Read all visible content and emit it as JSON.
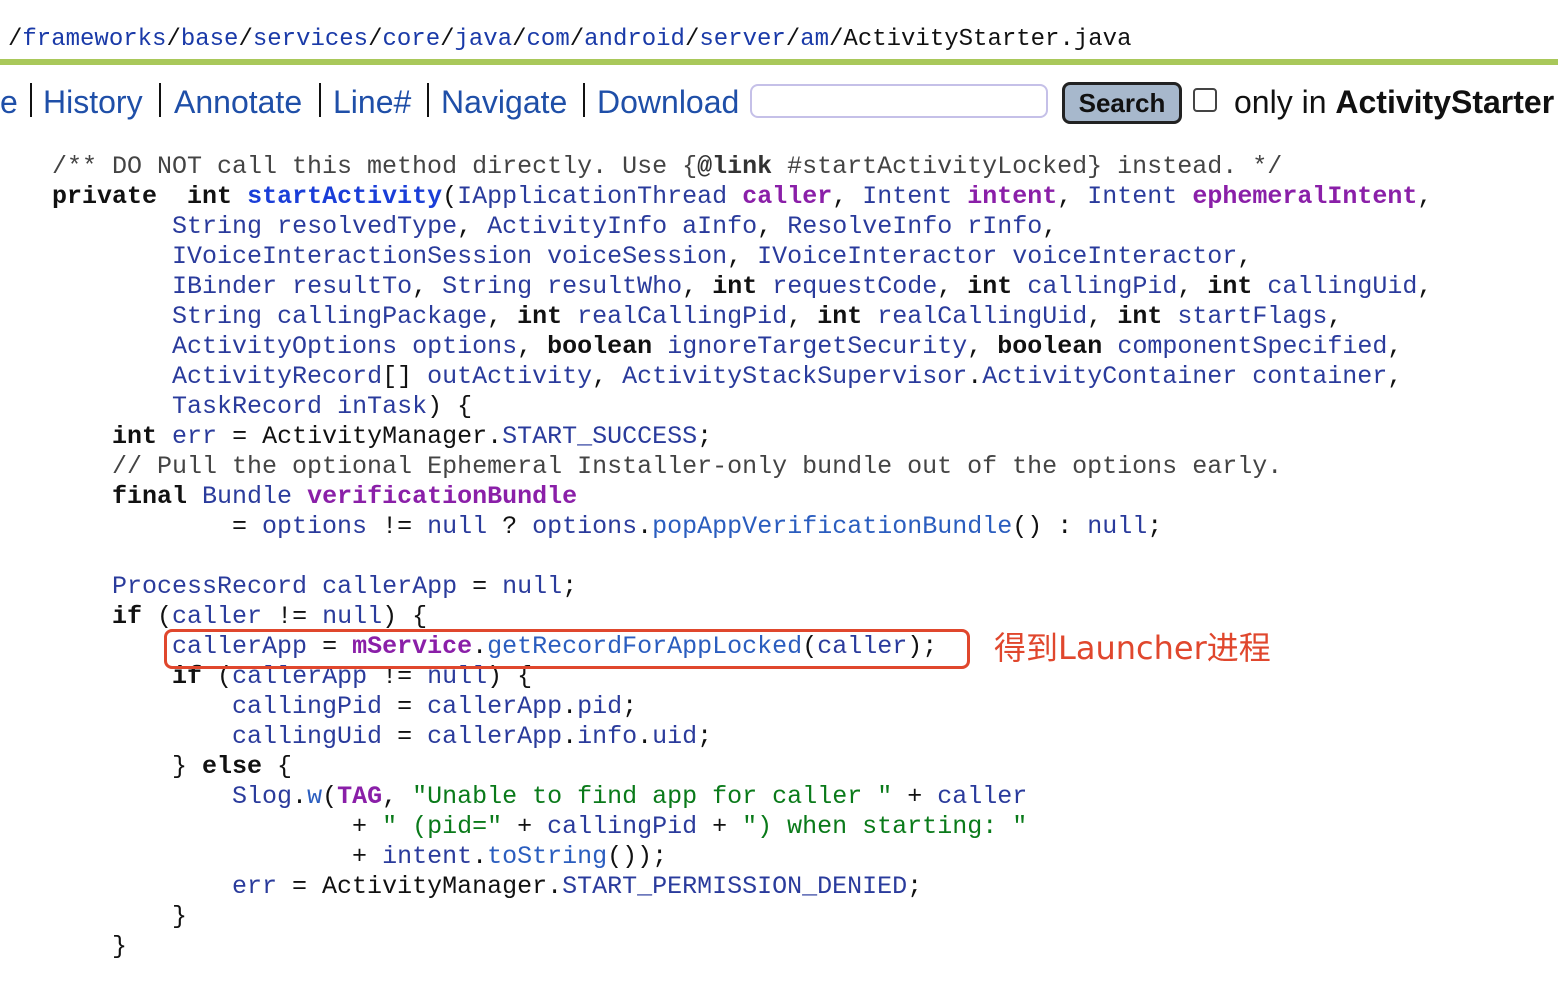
{
  "breadcrumb": {
    "sep": "/",
    "parts": [
      "frameworks",
      "base",
      "services",
      "core",
      "java",
      "com",
      "android",
      "server",
      "am",
      "ActivityStarter.java"
    ]
  },
  "navbar": {
    "items": [
      "e",
      "History",
      "Annotate",
      "Line#",
      "Navigate",
      "Download"
    ],
    "search_value": "",
    "search_button": "Search",
    "only_in": "only in",
    "only_in_target": "ActivityStarter"
  },
  "annotation": {
    "note": "得到Launcher进程",
    "box_color": "#e0472d"
  },
  "code": {
    "line01": [
      [
        "c",
        "/** DO NOT call this method directly. Use {"
      ],
      [
        "cb",
        "@link"
      ],
      [
        "c",
        " #startActivityLocked} instead. */"
      ]
    ],
    "line02": [
      [
        "k",
        "private"
      ],
      [
        "",
        "  "
      ],
      [
        "k",
        "int"
      ],
      [
        "",
        " "
      ],
      [
        "fb",
        "startActivity"
      ],
      [
        "",
        "("
      ],
      [
        "t",
        "IApplicationThread"
      ],
      [
        "",
        " "
      ],
      [
        "pb",
        "caller"
      ],
      [
        "",
        ", "
      ],
      [
        "t",
        "Intent"
      ],
      [
        "",
        " "
      ],
      [
        "pb",
        "intent"
      ],
      [
        "",
        ", "
      ],
      [
        "t",
        "Intent"
      ],
      [
        "",
        " "
      ],
      [
        "pb",
        "ephemeralIntent"
      ],
      [
        "",
        ","
      ]
    ],
    "line03": [
      [
        "",
        "        "
      ],
      [
        "t",
        "String"
      ],
      [
        "",
        " "
      ],
      [
        "v",
        "resolvedType"
      ],
      [
        "",
        ", "
      ],
      [
        "t",
        "ActivityInfo"
      ],
      [
        "",
        " "
      ],
      [
        "v",
        "aInfo"
      ],
      [
        "",
        ", "
      ],
      [
        "t",
        "ResolveInfo"
      ],
      [
        "",
        " "
      ],
      [
        "v",
        "rInfo"
      ],
      [
        "",
        ","
      ]
    ],
    "line04": [
      [
        "",
        "        "
      ],
      [
        "t",
        "IVoiceInteractionSession"
      ],
      [
        "",
        " "
      ],
      [
        "v",
        "voiceSession"
      ],
      [
        "",
        ", "
      ],
      [
        "t",
        "IVoiceInteractor"
      ],
      [
        "",
        " "
      ],
      [
        "v",
        "voiceInteractor"
      ],
      [
        "",
        ","
      ]
    ],
    "line05": [
      [
        "",
        "        "
      ],
      [
        "t",
        "IBinder"
      ],
      [
        "",
        " "
      ],
      [
        "v",
        "resultTo"
      ],
      [
        "",
        ", "
      ],
      [
        "t",
        "String"
      ],
      [
        "",
        " "
      ],
      [
        "v",
        "resultWho"
      ],
      [
        "",
        ", "
      ],
      [
        "k",
        "int"
      ],
      [
        "",
        " "
      ],
      [
        "v",
        "requestCode"
      ],
      [
        "",
        ", "
      ],
      [
        "k",
        "int"
      ],
      [
        "",
        " "
      ],
      [
        "v",
        "callingPid"
      ],
      [
        "",
        ", "
      ],
      [
        "k",
        "int"
      ],
      [
        "",
        " "
      ],
      [
        "v",
        "callingUid"
      ],
      [
        "",
        ","
      ]
    ],
    "line06": [
      [
        "",
        "        "
      ],
      [
        "t",
        "String"
      ],
      [
        "",
        " "
      ],
      [
        "v",
        "callingPackage"
      ],
      [
        "",
        ", "
      ],
      [
        "k",
        "int"
      ],
      [
        "",
        " "
      ],
      [
        "v",
        "realCallingPid"
      ],
      [
        "",
        ", "
      ],
      [
        "k",
        "int"
      ],
      [
        "",
        " "
      ],
      [
        "v",
        "realCallingUid"
      ],
      [
        "",
        ", "
      ],
      [
        "k",
        "int"
      ],
      [
        "",
        " "
      ],
      [
        "v",
        "startFlags"
      ],
      [
        "",
        ","
      ]
    ],
    "line07": [
      [
        "",
        "        "
      ],
      [
        "t",
        "ActivityOptions"
      ],
      [
        "",
        " "
      ],
      [
        "v",
        "options"
      ],
      [
        "",
        ", "
      ],
      [
        "k",
        "boolean"
      ],
      [
        "",
        " "
      ],
      [
        "v",
        "ignoreTargetSecurity"
      ],
      [
        "",
        ", "
      ],
      [
        "k",
        "boolean"
      ],
      [
        "",
        " "
      ],
      [
        "v",
        "componentSpecified"
      ],
      [
        "",
        ","
      ]
    ],
    "line08": [
      [
        "",
        "        "
      ],
      [
        "t",
        "ActivityRecord"
      ],
      [
        "",
        "[] "
      ],
      [
        "v",
        "outActivity"
      ],
      [
        "",
        ", "
      ],
      [
        "t",
        "ActivityStackSupervisor"
      ],
      [
        "",
        "."
      ],
      [
        "t",
        "ActivityContainer"
      ],
      [
        "",
        " "
      ],
      [
        "v",
        "container"
      ],
      [
        "",
        ","
      ]
    ],
    "line09": [
      [
        "",
        "        "
      ],
      [
        "t",
        "TaskRecord"
      ],
      [
        "",
        " "
      ],
      [
        "v",
        "inTask"
      ],
      [
        "",
        ") {"
      ]
    ],
    "line10": [
      [
        "",
        "    "
      ],
      [
        "k",
        "int"
      ],
      [
        "",
        " "
      ],
      [
        "v",
        "err"
      ],
      [
        "",
        " = ActivityManager."
      ],
      [
        "fd",
        "START_SUCCESS"
      ],
      [
        "",
        ";"
      ]
    ],
    "line11": [
      [
        "",
        "    "
      ],
      [
        "c",
        "// Pull the optional Ephemeral Installer-only bundle out of the options early."
      ]
    ],
    "line12": [
      [
        "",
        "    "
      ],
      [
        "k",
        "final"
      ],
      [
        "",
        " "
      ],
      [
        "t",
        "Bundle"
      ],
      [
        "",
        " "
      ],
      [
        "pb",
        "verificationBundle"
      ]
    ],
    "line13": [
      [
        "",
        "            = "
      ],
      [
        "v",
        "options"
      ],
      [
        "",
        " != "
      ],
      [
        "v",
        "null"
      ],
      [
        "",
        " ? "
      ],
      [
        "v",
        "options"
      ],
      [
        "",
        "."
      ],
      [
        "m",
        "popAppVerificationBundle"
      ],
      [
        "",
        "() : "
      ],
      [
        "v",
        "null"
      ],
      [
        "",
        ";"
      ]
    ],
    "line14": [],
    "line15": [
      [
        "",
        "    "
      ],
      [
        "t",
        "ProcessRecord"
      ],
      [
        "",
        " "
      ],
      [
        "v",
        "callerApp"
      ],
      [
        "",
        " = "
      ],
      [
        "v",
        "null"
      ],
      [
        "",
        ";"
      ]
    ],
    "line16": [
      [
        "",
        "    "
      ],
      [
        "k",
        "if"
      ],
      [
        "",
        " ("
      ],
      [
        "v",
        "caller"
      ],
      [
        "",
        " != "
      ],
      [
        "v",
        "null"
      ],
      [
        "",
        ") {"
      ]
    ],
    "line17": [
      [
        "",
        "        "
      ],
      [
        "v",
        "callerApp"
      ],
      [
        "",
        " = "
      ],
      [
        "pb",
        "mService"
      ],
      [
        "",
        "."
      ],
      [
        "m",
        "getRecordForAppLocked"
      ],
      [
        "",
        "("
      ],
      [
        "v",
        "caller"
      ],
      [
        "",
        ");"
      ]
    ],
    "line18": [
      [
        "",
        "        "
      ],
      [
        "k",
        "if"
      ],
      [
        "",
        " ("
      ],
      [
        "v",
        "callerApp"
      ],
      [
        "",
        " != "
      ],
      [
        "v",
        "null"
      ],
      [
        "",
        ") {"
      ]
    ],
    "line19": [
      [
        "",
        "            "
      ],
      [
        "v",
        "callingPid"
      ],
      [
        "",
        " = "
      ],
      [
        "v",
        "callerApp"
      ],
      [
        "",
        "."
      ],
      [
        "fd",
        "pid"
      ],
      [
        "",
        ";"
      ]
    ],
    "line20": [
      [
        "",
        "            "
      ],
      [
        "v",
        "callingUid"
      ],
      [
        "",
        " = "
      ],
      [
        "v",
        "callerApp"
      ],
      [
        "",
        "."
      ],
      [
        "fd",
        "info"
      ],
      [
        "",
        "."
      ],
      [
        "fd",
        "uid"
      ],
      [
        "",
        ";"
      ]
    ],
    "line21": [
      [
        "",
        "        } "
      ],
      [
        "k",
        "else"
      ],
      [
        "",
        " {"
      ]
    ],
    "line22": [
      [
        "",
        "            "
      ],
      [
        "t",
        "Slog"
      ],
      [
        "",
        "."
      ],
      [
        "m",
        "w"
      ],
      [
        "",
        "("
      ],
      [
        "pb",
        "TAG"
      ],
      [
        "",
        ", "
      ],
      [
        "s",
        "\"Unable to find app for caller \""
      ],
      [
        "",
        " + "
      ],
      [
        "v",
        "caller"
      ]
    ],
    "line23": [
      [
        "",
        "                    + "
      ],
      [
        "s",
        "\" (pid=\""
      ],
      [
        "",
        " + "
      ],
      [
        "v",
        "callingPid"
      ],
      [
        "",
        " + "
      ],
      [
        "s",
        "\") when starting: \""
      ]
    ],
    "line24": [
      [
        "",
        "                    + "
      ],
      [
        "v",
        "intent"
      ],
      [
        "",
        "."
      ],
      [
        "m",
        "toString"
      ],
      [
        "",
        "());"
      ]
    ],
    "line25": [
      [
        "",
        "            "
      ],
      [
        "v",
        "err"
      ],
      [
        "",
        " = ActivityManager."
      ],
      [
        "fd",
        "START_PERMISSION_DENIED"
      ],
      [
        "",
        ";"
      ]
    ],
    "line26": [
      [
        "",
        "        }"
      ]
    ],
    "line27": [
      [
        "",
        "    }"
      ]
    ]
  }
}
